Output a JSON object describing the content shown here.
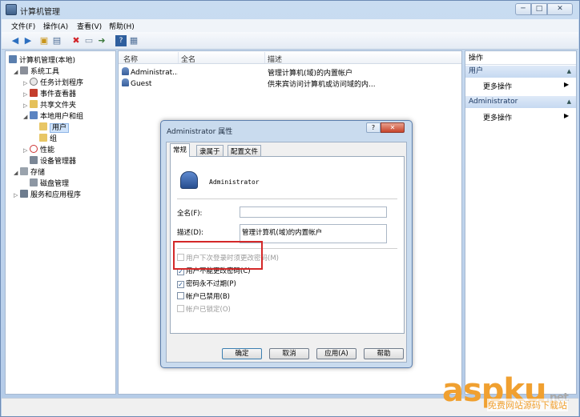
{
  "window": {
    "title": "计算机管理"
  },
  "menu": [
    "文件(F)",
    "操作(A)",
    "查看(V)",
    "帮助(H)"
  ],
  "toolbar_icons": [
    "back-arrow-icon",
    "forward-arrow-icon",
    "up-folder-icon",
    "show-hide-tree-icon",
    "delete-icon",
    "properties-icon",
    "export-icon",
    "help-icon",
    "console-icon"
  ],
  "tree": {
    "root": "计算机管理(本地)",
    "system_tools": "系统工具",
    "task_scheduler": "任务计划程序",
    "event_viewer": "事件查看器",
    "shared_folders": "共享文件夹",
    "local_users": "本地用户和组",
    "users": "用户",
    "groups": "组",
    "performance": "性能",
    "device_manager": "设备管理器",
    "storage": "存储",
    "disk_management": "磁盘管理",
    "services": "服务和应用程序"
  },
  "list": {
    "columns": [
      "名称",
      "全名",
      "描述"
    ],
    "rows": [
      {
        "name": "Administrat...",
        "fullname": "",
        "desc": "管理计算机(域)的内置帐户"
      },
      {
        "name": "Guest",
        "fullname": "",
        "desc": "供来宾访问计算机或访问域的内..."
      }
    ]
  },
  "actions": {
    "header": "操作",
    "group1": "用户",
    "more1": "更多操作",
    "group2": "Administrator",
    "more2": "更多操作"
  },
  "dialog": {
    "title": "Administrator 属性",
    "help_glyph": "?",
    "close_glyph": "✕",
    "tabs": [
      "常规",
      "隶属于",
      "配置文件"
    ],
    "username": "Administrator",
    "fullname_label": "全名(F):",
    "fullname_value": "",
    "desc_label": "描述(D):",
    "desc_value": "管理计算机(域)的内置帐户",
    "checkboxes": [
      {
        "label": "用户下次登录时须更改密码(M)",
        "checked": false,
        "disabled": true
      },
      {
        "label": "用户不能更改密码(C)",
        "checked": true,
        "disabled": false
      },
      {
        "label": "密码永不过期(P)",
        "checked": true,
        "disabled": false
      },
      {
        "label": "帐户已禁用(B)",
        "checked": false,
        "disabled": false
      },
      {
        "label": "帐户已锁定(O)",
        "checked": false,
        "disabled": true
      }
    ],
    "buttons": {
      "ok": "确定",
      "cancel": "取消",
      "apply": "应用(A)",
      "help": "帮助"
    }
  },
  "watermark": {
    "brand": "aspku",
    "suffix": ".net",
    "tagline": "免费网站源码下载站"
  },
  "colors": {
    "highlight_box": "#d42828",
    "watermark": "#f0a030"
  }
}
